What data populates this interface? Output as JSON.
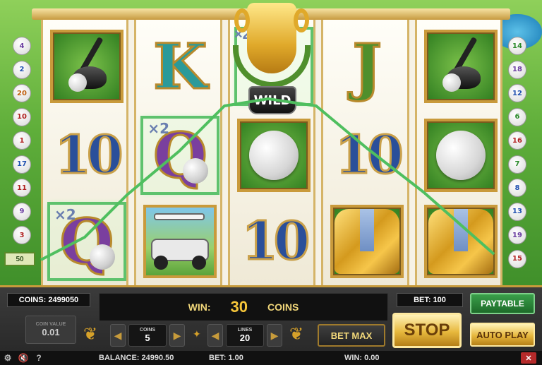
{
  "reels": {
    "wild_label": "WILD",
    "multiplier_x2": "×2",
    "ten_label": "10",
    "letter_k": "K",
    "letter_j": "J",
    "letter_q": "Q"
  },
  "paylines": {
    "left": [
      "4",
      "2",
      "20",
      "10",
      "1",
      "17",
      "11",
      "9",
      "3"
    ],
    "right": [
      "14",
      "18",
      "12",
      "6",
      "16",
      "7",
      "8",
      "13",
      "19",
      "15"
    ],
    "active_left": "50"
  },
  "panel": {
    "coins": "COINS: 2499050",
    "coin_value_label": "COIN VALUE",
    "coin_value": "0.01",
    "win_label": "WIN:",
    "win_amount": "30",
    "win_unit": "COINS",
    "bet": "BET: 100",
    "paytable": "PAYTABLE",
    "coins_label": "COINS",
    "coins_count": "5",
    "lines_label": "LINES",
    "lines_count": "20",
    "bet_max": "BET MAX",
    "stop": "STOP",
    "auto_play": "AUTO PLAY"
  },
  "status": {
    "help": "?",
    "balance": "BALANCE: 24990.50",
    "bet": "BET: 1.00",
    "win": "WIN: 0.00",
    "close": "✕"
  },
  "colors": {
    "win_line": "#4fbf5f",
    "gold": "#c79b3b"
  }
}
